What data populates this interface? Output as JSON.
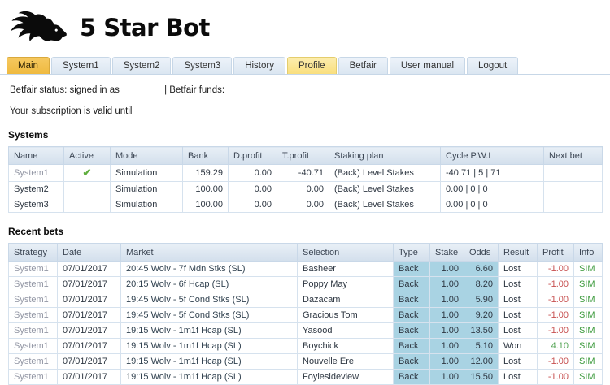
{
  "header": {
    "title": "5 Star Bot",
    "logo_icon": "horse-head-icon"
  },
  "tabs": [
    {
      "label": "Main",
      "state": "active"
    },
    {
      "label": "System1",
      "state": ""
    },
    {
      "label": "System2",
      "state": ""
    },
    {
      "label": "System3",
      "state": ""
    },
    {
      "label": "History",
      "state": ""
    },
    {
      "label": "Profile",
      "state": "highlight"
    },
    {
      "label": "Betfair",
      "state": ""
    },
    {
      "label": "User manual",
      "state": ""
    },
    {
      "label": "Logout",
      "state": ""
    }
  ],
  "status": {
    "betfair_status": "Betfair status: signed in as",
    "betfair_funds": "| Betfair funds:",
    "subscription": "Your subscription is valid until"
  },
  "systems": {
    "heading": "Systems",
    "columns": [
      "Name",
      "Active",
      "Mode",
      "Bank",
      "D.profit",
      "T.profit",
      "Staking plan",
      "Cycle P.W.L",
      "Next bet"
    ],
    "active_check_icon": "check-icon",
    "rows": [
      {
        "name": "System1",
        "active_mark": "✔",
        "mode": "Simulation",
        "bank": "159.29",
        "d_profit": "0.00",
        "t_profit": "-40.71",
        "staking_plan": "(Back) Level Stakes",
        "cycle_pwl": "-40.71 | 5 | 71",
        "next_bet": ""
      },
      {
        "name": "System2",
        "active_mark": "",
        "mode": "Simulation",
        "bank": "100.00",
        "d_profit": "0.00",
        "t_profit": "0.00",
        "staking_plan": "(Back) Level Stakes",
        "cycle_pwl": "0.00 | 0 | 0",
        "next_bet": ""
      },
      {
        "name": "System3",
        "active_mark": "",
        "mode": "Simulation",
        "bank": "100.00",
        "d_profit": "0.00",
        "t_profit": "0.00",
        "staking_plan": "(Back) Level Stakes",
        "cycle_pwl": "0.00 | 0 | 0",
        "next_bet": ""
      }
    ]
  },
  "recent_bets": {
    "heading": "Recent bets",
    "columns": [
      "Strategy",
      "Date",
      "Market",
      "Selection",
      "Type",
      "Stake",
      "Odds",
      "Result",
      "Profit",
      "Info"
    ],
    "rows": [
      {
        "strategy": "System1",
        "date": "07/01/2017",
        "market": "20:45 Wolv - 7f Mdn Stks (SL)",
        "selection": "Basheer",
        "type": "Back",
        "stake": "1.00",
        "odds": "6.60",
        "result": "Lost",
        "profit": "-1.00",
        "info": "SIM"
      },
      {
        "strategy": "System1",
        "date": "07/01/2017",
        "market": "20:15 Wolv - 6f Hcap (SL)",
        "selection": "Poppy May",
        "type": "Back",
        "stake": "1.00",
        "odds": "8.20",
        "result": "Lost",
        "profit": "-1.00",
        "info": "SIM"
      },
      {
        "strategy": "System1",
        "date": "07/01/2017",
        "market": "19:45 Wolv - 5f Cond Stks (SL)",
        "selection": "Dazacam",
        "type": "Back",
        "stake": "1.00",
        "odds": "5.90",
        "result": "Lost",
        "profit": "-1.00",
        "info": "SIM"
      },
      {
        "strategy": "System1",
        "date": "07/01/2017",
        "market": "19:45 Wolv - 5f Cond Stks (SL)",
        "selection": "Gracious Tom",
        "type": "Back",
        "stake": "1.00",
        "odds": "9.20",
        "result": "Lost",
        "profit": "-1.00",
        "info": "SIM"
      },
      {
        "strategy": "System1",
        "date": "07/01/2017",
        "market": "19:15 Wolv - 1m1f Hcap (SL)",
        "selection": "Yasood",
        "type": "Back",
        "stake": "1.00",
        "odds": "13.50",
        "result": "Lost",
        "profit": "-1.00",
        "info": "SIM"
      },
      {
        "strategy": "System1",
        "date": "07/01/2017",
        "market": "19:15 Wolv - 1m1f Hcap (SL)",
        "selection": "Boychick",
        "type": "Back",
        "stake": "1.00",
        "odds": "5.10",
        "result": "Won",
        "profit": "4.10",
        "info": "SIM"
      },
      {
        "strategy": "System1",
        "date": "07/01/2017",
        "market": "19:15 Wolv - 1m1f Hcap (SL)",
        "selection": "Nouvelle Ere",
        "type": "Back",
        "stake": "1.00",
        "odds": "12.00",
        "result": "Lost",
        "profit": "-1.00",
        "info": "SIM"
      },
      {
        "strategy": "System1",
        "date": "07/01/2017",
        "market": "19:15 Wolv - 1m1f Hcap (SL)",
        "selection": "Foylesideview",
        "type": "Back",
        "stake": "1.00",
        "odds": "15.50",
        "result": "Lost",
        "profit": "-1.00",
        "info": "SIM"
      }
    ]
  },
  "colors": {
    "active_tab": "#efba40",
    "profile_tab": "#f9df7e",
    "highlight_cell": "#a9d3e3",
    "profit_negative": "#c75050",
    "profit_positive": "#55a555",
    "sim_green": "#3e9b3e",
    "check_green": "#5fae3e"
  }
}
